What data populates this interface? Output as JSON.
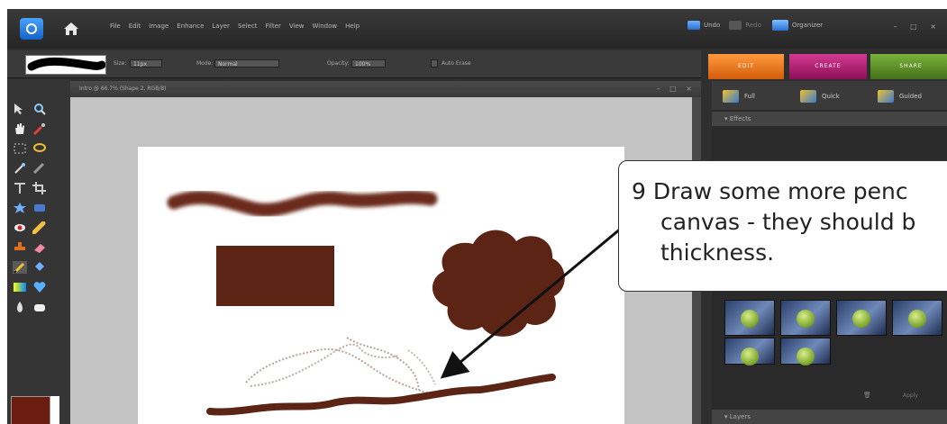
{
  "menubar": {
    "items": [
      "File",
      "Edit",
      "Image",
      "Enhance",
      "Layer",
      "Select",
      "Filter",
      "View",
      "Window",
      "Help"
    ],
    "undo_label": "Undo",
    "redo_label": "Redo",
    "organizer_label": "Organizer"
  },
  "options_bar": {
    "size_label": "Size:",
    "size_value": "11px",
    "mode_label": "Mode:",
    "mode_value": "Normal",
    "opacity_label": "Opacity:",
    "opacity_value": "100%",
    "autoerase_label": "Auto Erase"
  },
  "mode_tabs": {
    "edit": "EDIT",
    "create": "CREATE",
    "share": "SHARE"
  },
  "document": {
    "title": "Intro @ 66.7% (Shape 2, RGB/8)"
  },
  "panel": {
    "tab_full": "Full",
    "tab_quick": "Quick",
    "tab_guided": "Guided",
    "effects_header": "Effects",
    "apply_label": "Apply",
    "layers_header": "Layers"
  },
  "callout": {
    "line1": "9 Draw some more penc",
    "line2": "canvas - they should b",
    "line3": "thickness."
  },
  "colors": {
    "brush": "#5c2414",
    "foreground": "#6b1d10",
    "edit_tab": "#e8701a",
    "create_tab": "#b0176e",
    "share_tab": "#5f8c1f"
  }
}
